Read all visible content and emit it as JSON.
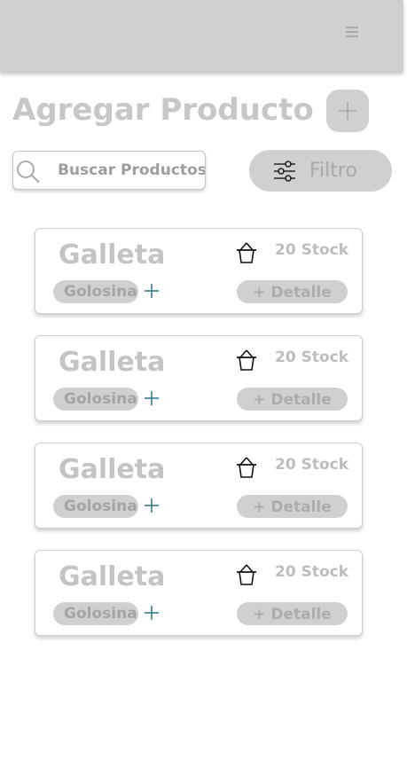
{
  "header": {
    "menu_icon": "hamburger-menu-icon"
  },
  "page": {
    "title": "Agregar Producto",
    "add_icon": "plus-icon"
  },
  "search": {
    "placeholder": "Buscar Productos",
    "icon": "search-icon"
  },
  "filter": {
    "label": "Filtro",
    "icon": "sliders-icon"
  },
  "products": [
    {
      "name": "Galleta",
      "stock": "20 Stock",
      "category": "Golosina",
      "detail_label": "+ Detalle"
    },
    {
      "name": "Galleta",
      "stock": "20 Stock",
      "category": "Golosina",
      "detail_label": "+ Detalle"
    },
    {
      "name": "Galleta",
      "stock": "20 Stock",
      "category": "Golosina",
      "detail_label": "+ Detalle"
    },
    {
      "name": "Galleta",
      "stock": "20 Stock",
      "category": "Golosina",
      "detail_label": "+ Detalle"
    }
  ],
  "colors": {
    "topbar": "#d0d0d0",
    "pill": "#d0d0d0",
    "add_category_accent": "#3a7d8a"
  }
}
